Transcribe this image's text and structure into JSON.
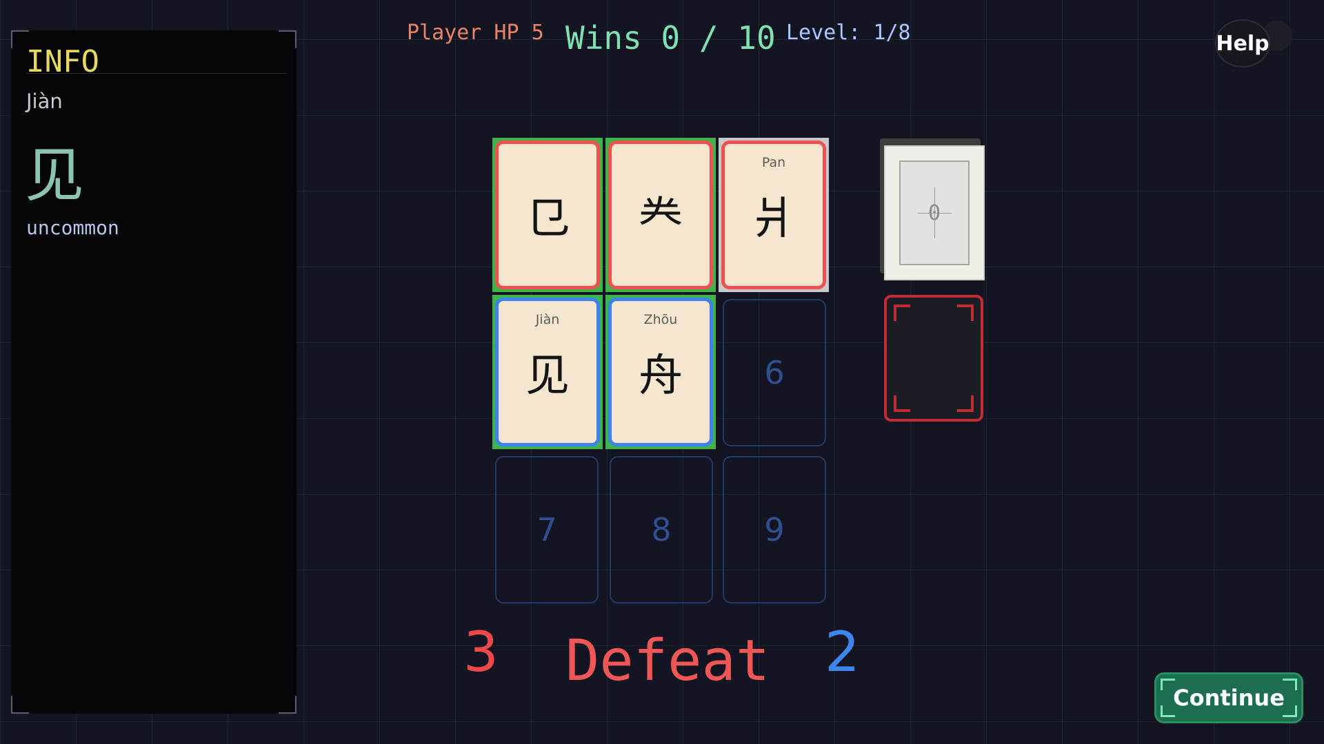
{
  "info": {
    "title": "INFO",
    "pinyin": "Jiàn",
    "character": "见",
    "rarity": "uncommon"
  },
  "hud": {
    "player_hp": "Player HP 5",
    "wins": "Wins 0 / 10",
    "level": "Level: 1/8",
    "help_label": "Help"
  },
  "board": {
    "enemy_cards": [
      {
        "pinyin": "",
        "character": "㔾"
      },
      {
        "pinyin": "",
        "character": "龹"
      },
      {
        "pinyin": "Pan",
        "character": "爿"
      }
    ],
    "player_cards": [
      {
        "pinyin": "Jiàn",
        "character": "见"
      },
      {
        "pinyin": "Zhōu",
        "character": "舟"
      }
    ],
    "empty_slots": [
      "6",
      "7",
      "8",
      "9"
    ]
  },
  "deck": {
    "count": "0"
  },
  "result": {
    "enemy_score": "3",
    "label": "Defeat",
    "player_score": "2"
  },
  "continue_label": "Continue",
  "colors": {
    "enemy_border": "#ef5050",
    "player_border": "#3d82f0",
    "win_highlight": "#3fb24a",
    "accent_info": "#e6da5e"
  }
}
